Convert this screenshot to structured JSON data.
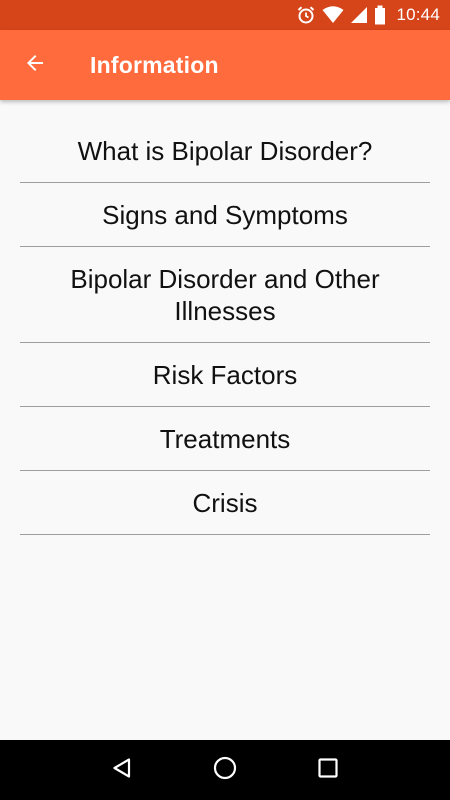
{
  "status_bar": {
    "time": "10:44",
    "icons": [
      "alarm-icon",
      "wifi-icon",
      "signal-icon",
      "battery-icon"
    ]
  },
  "app_bar": {
    "title": "Information",
    "back_icon": "arrow-back-icon",
    "color": "#ff6b3d",
    "status_color": "#d6441a"
  },
  "menu": {
    "items": [
      {
        "label": "What is Bipolar Disorder?"
      },
      {
        "label": "Signs and Symptoms"
      },
      {
        "label": "Bipolar Disorder and Other Illnesses"
      },
      {
        "label": "Risk Factors"
      },
      {
        "label": "Treatments"
      },
      {
        "label": "Crisis"
      }
    ]
  },
  "nav_bar": {
    "buttons": [
      "back-triangle-icon",
      "home-circle-icon",
      "recents-square-icon"
    ]
  }
}
